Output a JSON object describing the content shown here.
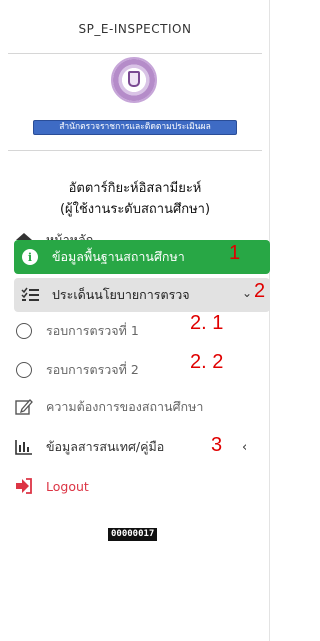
{
  "brand": {
    "title": "SP_E-INSPECTION"
  },
  "org": {
    "banner": "สำนักตรวจราชการและติดตามประเมินผล"
  },
  "user": {
    "name": "อัตตาร์กิยะห์อิสลามียะห์",
    "role": "(ผู้ใช้งานระดับสถานศึกษา)"
  },
  "nav": {
    "home": "หน้าหลัก",
    "school_info": "ข้อมูลพื้นฐานสถานศึกษา",
    "policy": "ประเด็นนโยบายการตรวจ",
    "round1": "รอบการตรวจที่ 1",
    "round2": "รอบการตรวจที่ 2",
    "needs": "ความต้องการของสถานศึกษา",
    "docs": "ข้อมูลสารสนเทศ/คู่มือ",
    "logout": "Logout"
  },
  "annotations": {
    "a1": "1",
    "a2": "2",
    "a21": "2. 1",
    "a22": "2. 2",
    "a3": "3"
  },
  "counter": "00000017",
  "colors": {
    "active": "#28a745",
    "logout": "#dc3545",
    "annotation": "#e00000",
    "banner": "#3e6bc4"
  }
}
